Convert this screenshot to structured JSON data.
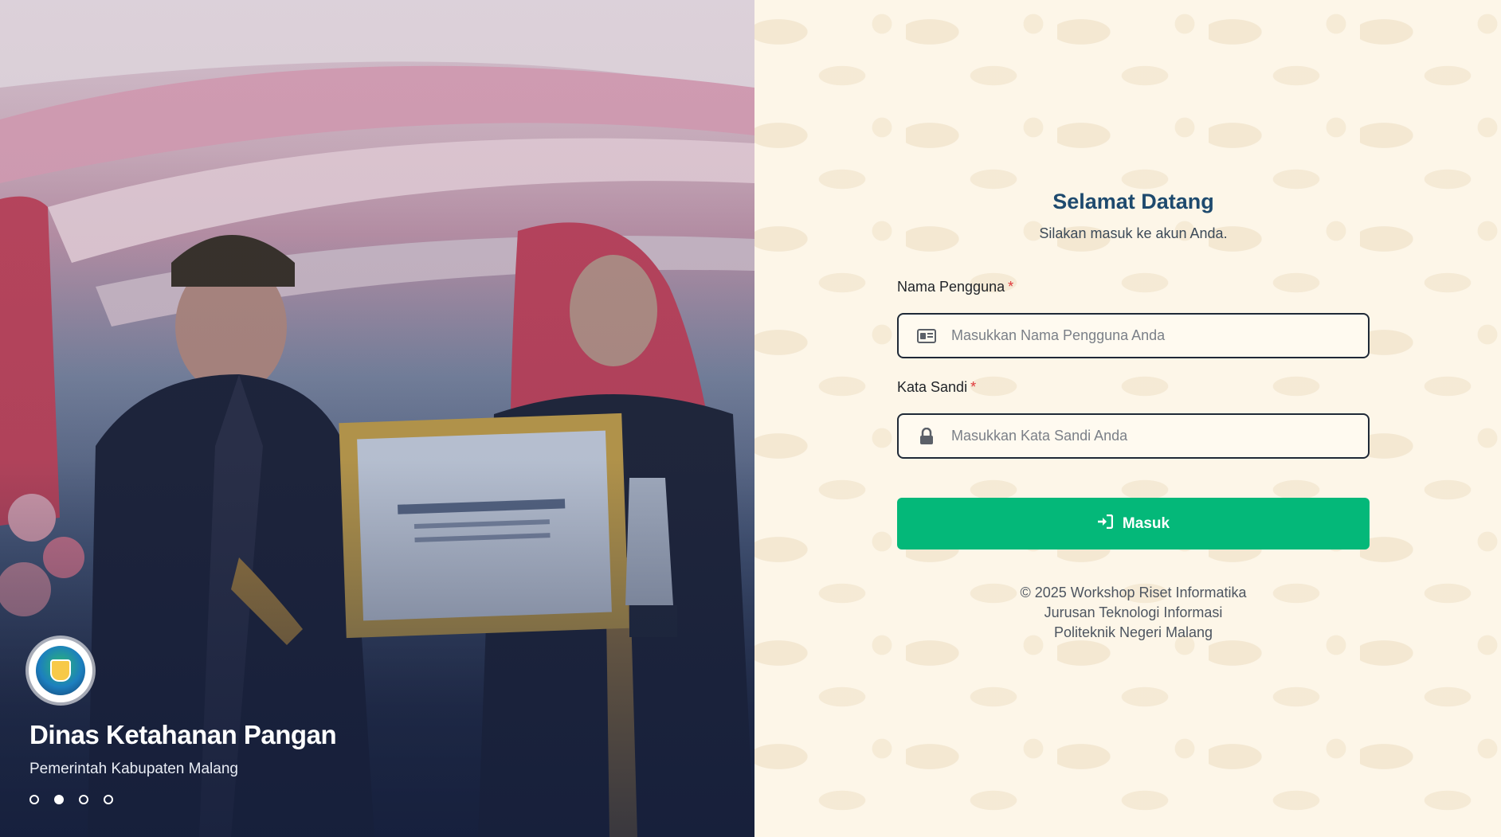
{
  "hero": {
    "title": "Dinas Ketahanan Pangan",
    "subtitle": "Pemerintah Kabupaten Malang",
    "slides": [
      {
        "active": false
      },
      {
        "active": true
      },
      {
        "active": false
      },
      {
        "active": false
      }
    ]
  },
  "login": {
    "heading": "Selamat Datang",
    "subheading": "Silakan masuk ke akun Anda.",
    "username": {
      "label": "Nama Pengguna",
      "required_mark": "*",
      "placeholder": "Masukkan Nama Pengguna Anda",
      "value": "",
      "icon": "id-card-icon"
    },
    "password": {
      "label": "Kata Sandi",
      "required_mark": "*",
      "placeholder": "Masukkan Kata Sandi Anda",
      "value": "",
      "icon": "lock-icon"
    },
    "submit": {
      "label": "Masuk",
      "icon": "sign-in-icon"
    },
    "footer": {
      "line1": "© 2025 Workshop Riset Informatika",
      "line2": "Jurusan Teknologi Informasi",
      "line3": "Politeknik Negeri Malang"
    }
  },
  "colors": {
    "primary_button": "#04b879",
    "heading": "#1e4a6e",
    "required": "#e0383b",
    "panel_background": "#fdf6e8"
  }
}
